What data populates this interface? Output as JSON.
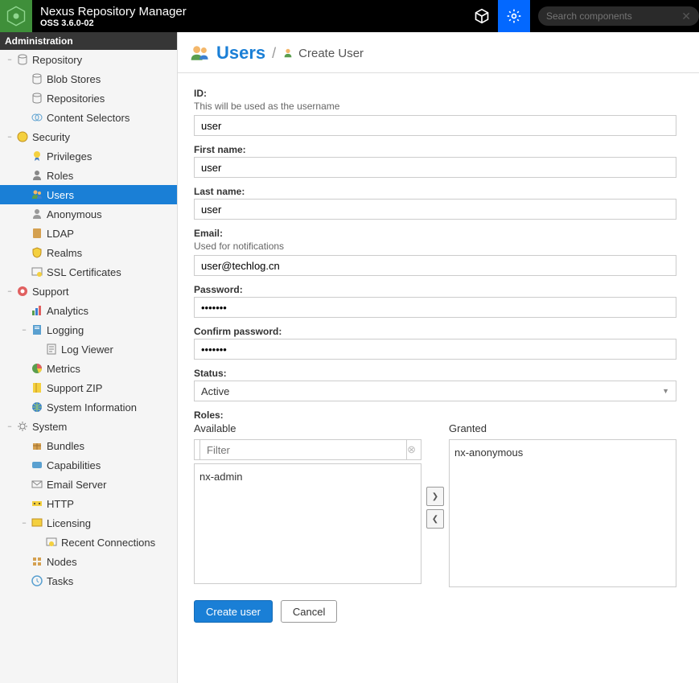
{
  "header": {
    "product_name": "Nexus Repository Manager",
    "product_version": "OSS 3.6.0-02",
    "search_placeholder": "Search components"
  },
  "sidebar": {
    "title": "Administration",
    "groups": [
      {
        "label": "Repository",
        "icon": "db",
        "expanded": true,
        "depth": 0,
        "children": [
          {
            "label": "Blob Stores",
            "icon": "db",
            "depth": 1
          },
          {
            "label": "Repositories",
            "icon": "db",
            "depth": 1
          },
          {
            "label": "Content Selectors",
            "icon": "tags",
            "depth": 1
          }
        ]
      },
      {
        "label": "Security",
        "icon": "security",
        "expanded": true,
        "depth": 0,
        "children": [
          {
            "label": "Privileges",
            "icon": "medal",
            "depth": 1
          },
          {
            "label": "Roles",
            "icon": "person",
            "depth": 1
          },
          {
            "label": "Users",
            "icon": "users",
            "depth": 1,
            "selected": true
          },
          {
            "label": "Anonymous",
            "icon": "anon",
            "depth": 1
          },
          {
            "label": "LDAP",
            "icon": "book",
            "depth": 1
          },
          {
            "label": "Realms",
            "icon": "shield",
            "depth": 1
          },
          {
            "label": "SSL Certificates",
            "icon": "cert",
            "depth": 1
          }
        ]
      },
      {
        "label": "Support",
        "icon": "support",
        "expanded": true,
        "depth": 0,
        "children": [
          {
            "label": "Analytics",
            "icon": "chart",
            "depth": 1
          },
          {
            "label": "Logging",
            "icon": "doc",
            "depth": 1,
            "expanded": true,
            "children": [
              {
                "label": "Log Viewer",
                "icon": "doc2",
                "depth": 2
              }
            ]
          },
          {
            "label": "Metrics",
            "icon": "pie",
            "depth": 1
          },
          {
            "label": "Support ZIP",
            "icon": "zip",
            "depth": 1
          },
          {
            "label": "System Information",
            "icon": "globe",
            "depth": 1
          }
        ]
      },
      {
        "label": "System",
        "icon": "gear",
        "expanded": true,
        "depth": 0,
        "children": [
          {
            "label": "Bundles",
            "icon": "bundle",
            "depth": 1
          },
          {
            "label": "Capabilities",
            "icon": "cap",
            "depth": 1
          },
          {
            "label": "Email Server",
            "icon": "mail",
            "depth": 1
          },
          {
            "label": "HTTP",
            "icon": "http",
            "depth": 1
          },
          {
            "label": "Licensing",
            "icon": "lic",
            "depth": 1,
            "expanded": true,
            "children": [
              {
                "label": "Recent Connections",
                "icon": "conn",
                "depth": 2
              }
            ]
          },
          {
            "label": "Nodes",
            "icon": "nodes",
            "depth": 1
          },
          {
            "label": "Tasks",
            "icon": "clock",
            "depth": 1
          }
        ]
      }
    ]
  },
  "page": {
    "title": "Users",
    "subtitle": "Create User"
  },
  "form": {
    "id_label": "ID:",
    "id_hint": "This will be used as the username",
    "id_value": "user",
    "first_label": "First name:",
    "first_value": "user",
    "last_label": "Last name:",
    "last_value": "user",
    "email_label": "Email:",
    "email_hint": "Used for notifications",
    "email_value": "user@techlog.cn",
    "password_label": "Password:",
    "password_value": "•••••••",
    "confirm_label": "Confirm password:",
    "confirm_value": "•••••••",
    "status_label": "Status:",
    "status_value": "Active",
    "roles_label": "Roles:",
    "available_label": "Available",
    "granted_label": "Granted",
    "filter_placeholder": "Filter",
    "available_items": [
      "nx-admin"
    ],
    "granted_items": [
      "nx-anonymous"
    ],
    "create_label": "Create user",
    "cancel_label": "Cancel"
  }
}
